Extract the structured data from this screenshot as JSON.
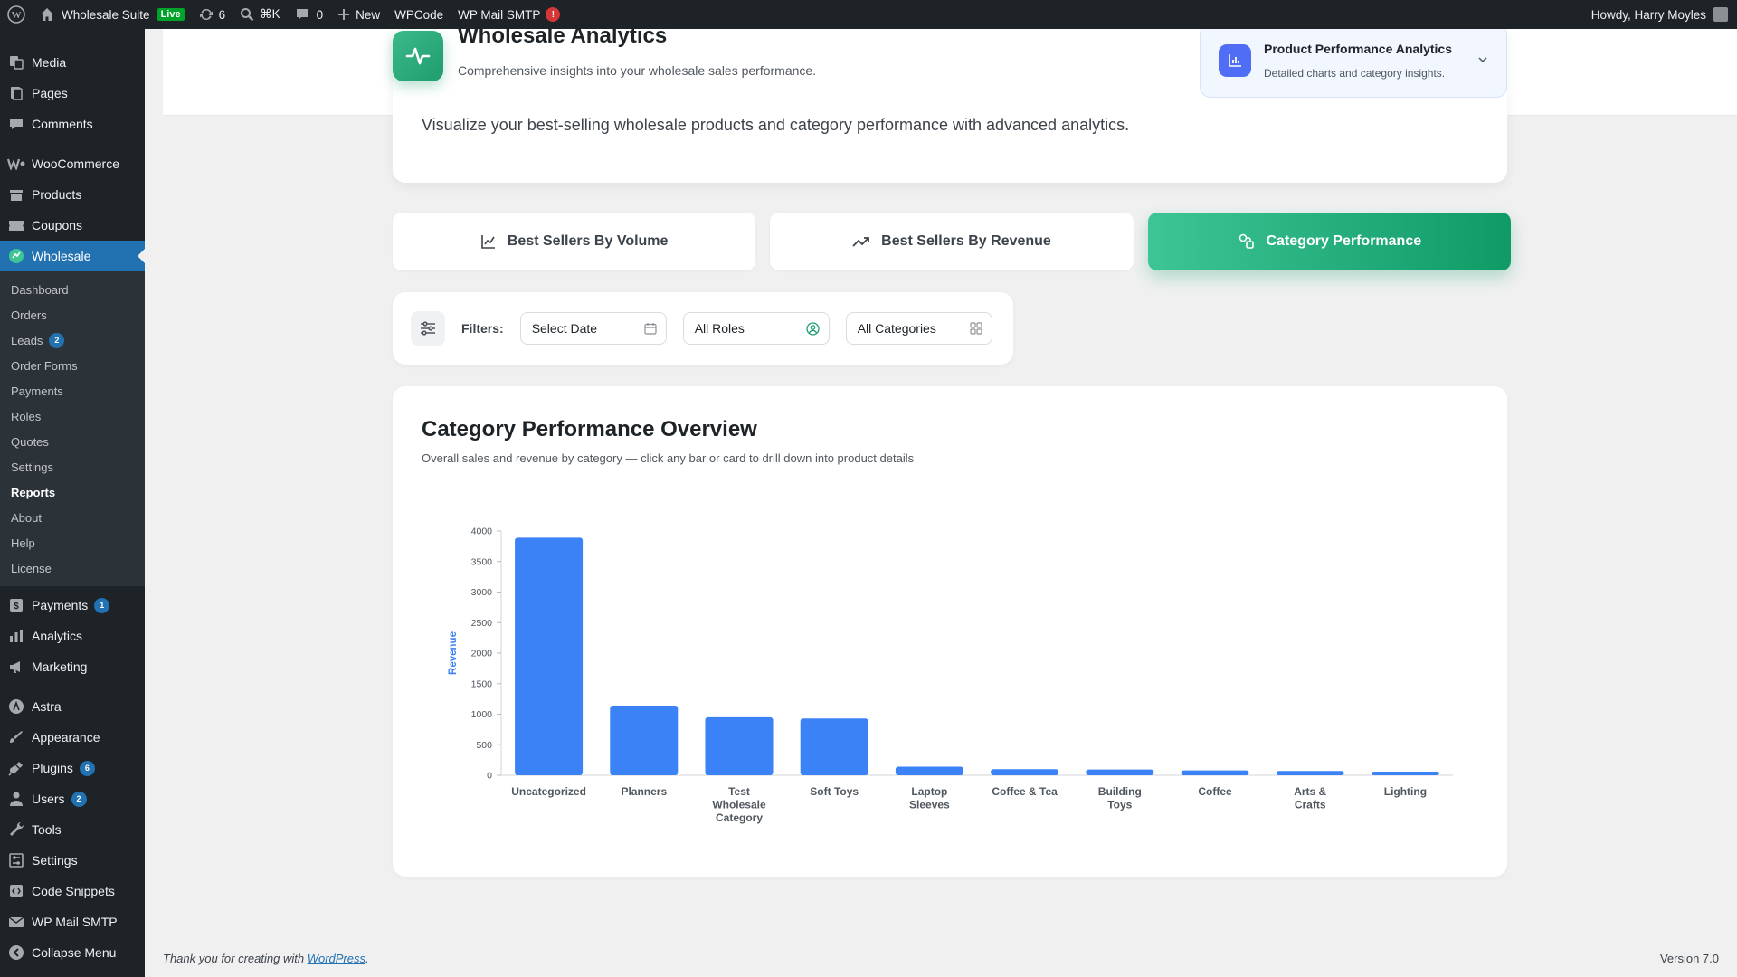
{
  "adminbar": {
    "site_name": "Wholesale Suite",
    "live": "Live",
    "updates": "6",
    "shortcut": "⌘K",
    "comments": "0",
    "new": "New",
    "wpcode": "WPCode",
    "wpmail": "WP Mail SMTP",
    "wpmail_notice": "!",
    "howdy": "Howdy, Harry Moyles"
  },
  "sidebar": {
    "items_top": [
      {
        "label": "Media",
        "icon": "media-icon"
      },
      {
        "label": "Pages",
        "icon": "pages-icon"
      },
      {
        "label": "Comments",
        "icon": "comments-icon"
      }
    ],
    "items_mid": [
      {
        "label": "WooCommerce",
        "icon": "woocommerce-icon"
      },
      {
        "label": "Products",
        "icon": "products-icon"
      },
      {
        "label": "Coupons",
        "icon": "coupons-icon"
      }
    ],
    "current": {
      "label": "Wholesale",
      "icon": "wholesale-icon"
    },
    "submenu": [
      {
        "label": "Dashboard"
      },
      {
        "label": "Orders"
      },
      {
        "label": "Leads",
        "count": "2"
      },
      {
        "label": "Order Forms"
      },
      {
        "label": "Payments"
      },
      {
        "label": "Roles"
      },
      {
        "label": "Quotes"
      },
      {
        "label": "Settings"
      },
      {
        "label": "Reports"
      },
      {
        "label": "About"
      },
      {
        "label": "Help"
      },
      {
        "label": "License"
      }
    ],
    "items_after": [
      {
        "label": "Payments",
        "count": "1",
        "icon": "payments-icon"
      },
      {
        "label": "Analytics",
        "icon": "analytics-icon"
      },
      {
        "label": "Marketing",
        "icon": "marketing-icon"
      }
    ],
    "items_bottom": [
      {
        "label": "Astra",
        "icon": "astra-icon"
      },
      {
        "label": "Appearance",
        "icon": "appearance-icon"
      },
      {
        "label": "Plugins",
        "count": "6",
        "icon": "plugins-icon"
      },
      {
        "label": "Users",
        "count": "2",
        "icon": "users-icon"
      },
      {
        "label": "Tools",
        "icon": "tools-icon"
      },
      {
        "label": "Settings",
        "icon": "settings-icon"
      },
      {
        "label": "Code Snippets",
        "icon": "code-snippets-icon"
      },
      {
        "label": "WP Mail SMTP",
        "icon": "wp-mail-smtp-icon"
      },
      {
        "label": "Collapse Menu",
        "icon": "collapse-icon"
      }
    ]
  },
  "header": {
    "title": "Wholesale Analytics",
    "subtitle": "Comprehensive insights into your wholesale sales performance.",
    "ppa_title": "Product Performance Analytics",
    "ppa_sub": "Detailed charts and category insights.",
    "hero_desc": "Visualize your best-selling wholesale products and category performance with advanced analytics."
  },
  "tabs": [
    {
      "label": "Best Sellers By Volume",
      "icon": "line-chart-icon"
    },
    {
      "label": "Best Sellers By Revenue",
      "icon": "trending-up-icon"
    },
    {
      "label": "Category Performance",
      "icon": "category-icon"
    }
  ],
  "filters": {
    "label": "Filters:",
    "date": "Select Date",
    "roles": "All Roles",
    "categories": "All Categories"
  },
  "chart": {
    "title": "Category Performance Overview",
    "subtitle": "Overall sales and revenue by category — click any bar or card to drill down into product details"
  },
  "chart_data": {
    "type": "bar",
    "ylabel": "Revenue",
    "xlabel": "",
    "ylim": [
      0,
      4000
    ],
    "yticks": [
      0,
      500,
      1000,
      1500,
      2000,
      2500,
      3000,
      3500,
      4000
    ],
    "categories": [
      [
        "Uncategorized"
      ],
      [
        "Planners"
      ],
      [
        "Test",
        "Wholesale",
        "Category"
      ],
      [
        "Soft Toys"
      ],
      [
        "Laptop",
        "Sleeves"
      ],
      [
        "Coffee & Tea"
      ],
      [
        "Building",
        "Toys"
      ],
      [
        "Coffee"
      ],
      [
        "Arts &",
        "Crafts"
      ],
      [
        "Lighting"
      ]
    ],
    "values": [
      3890,
      1140,
      950,
      930,
      140,
      100,
      95,
      80,
      70,
      60
    ],
    "bar_color": "#3b82f6",
    "grid": false
  },
  "footer": {
    "thanks": "Thank you for creating with ",
    "wp_link": "WordPress",
    "period": ".",
    "version": "Version 7.0"
  }
}
